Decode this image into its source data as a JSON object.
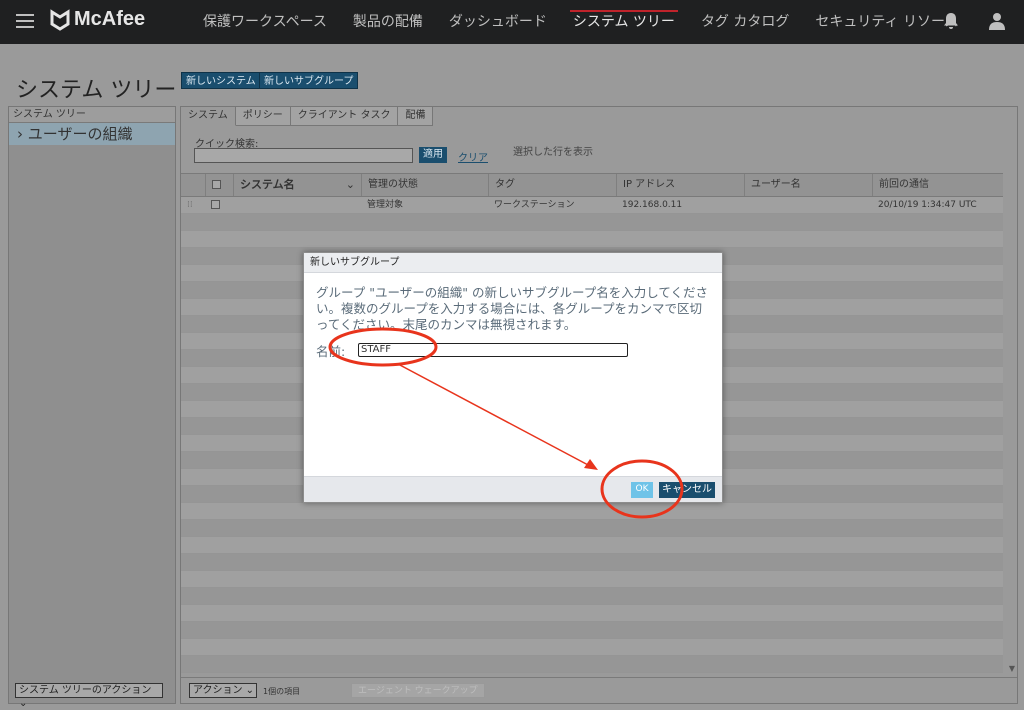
{
  "brand": {
    "name": "McAfee"
  },
  "nav": {
    "items": [
      {
        "label": "保護ワークスペース"
      },
      {
        "label": "製品の配備"
      },
      {
        "label": "ダッシュボード"
      },
      {
        "label": "システム ツリー"
      },
      {
        "label": "タグ カタログ"
      },
      {
        "label": "セキュリティ リソース"
      }
    ],
    "active_index": 3
  },
  "page": {
    "title": "システム ツリー",
    "new_system_label": "新しいシステム",
    "new_subgroup_label": "新しいサブグループ"
  },
  "tree": {
    "header": "システム ツリー",
    "items": [
      {
        "label": "› ユーザーの組織"
      }
    ],
    "action_label": "システム ツリーのアクション"
  },
  "tabs": [
    {
      "label": "システム"
    },
    {
      "label": "ポリシー"
    },
    {
      "label": "クライアント タスク"
    },
    {
      "label": "配備"
    }
  ],
  "quick_search": {
    "label": "クイック検索:",
    "value": "",
    "apply_label": "適用",
    "clear_label": "クリア",
    "show_selected_label": "選択した行を表示"
  },
  "table": {
    "columns": [
      "システム名",
      "管理の状態",
      "タグ",
      "IP アドレス",
      "ユーザー名",
      "前回の通信"
    ],
    "rows": [
      {
        "name": "",
        "status": "管理対象",
        "tag": "ワークステーション",
        "ip": "192.168.0.11",
        "user": "",
        "last": "20/10/19 1:34:47 UTC"
      }
    ]
  },
  "footer": {
    "action_label": "アクション",
    "selected_count": "1個の項目",
    "wake_label": "エージェント ウェークアップ"
  },
  "dialog": {
    "title": "新しいサブグループ",
    "message": "グループ \"ユーザーの組織\" の新しいサブグループ名を入力してください。複数のグループを入力する場合には、各グループをカンマで区切ってください。末尾のカンマは無視されます。",
    "name_label": "名前:",
    "name_value": "STAFF",
    "ok_label": "OK",
    "cancel_label": "キャンセル"
  },
  "colors": {
    "topbar": "#1f2021",
    "accent": "#1a4e6e",
    "nav_active_bar": "#c0232b",
    "annotation": "#e8341c"
  }
}
